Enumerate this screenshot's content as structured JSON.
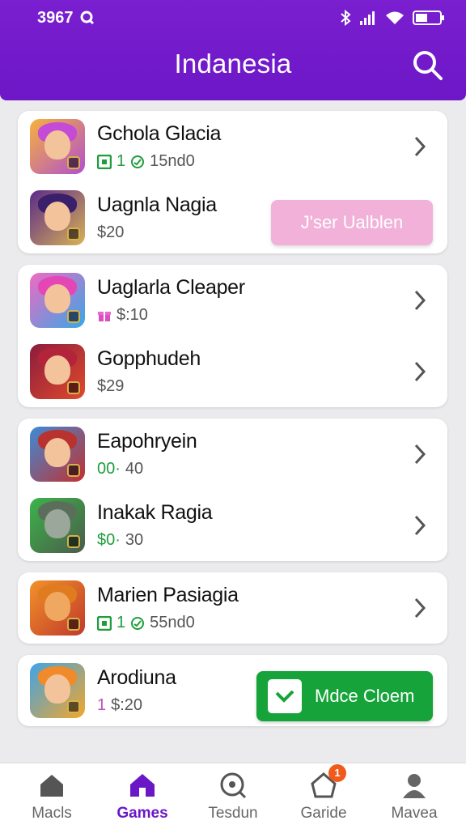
{
  "status_bar": {
    "time": "3967"
  },
  "header": {
    "title": "Indanesia"
  },
  "games": [
    {
      "name": "Gchola Glacia",
      "meta": "15nd0",
      "meta_prefix": "1",
      "colors": [
        "#f6b23a",
        "#b14fd1"
      ]
    },
    {
      "name": "Uagnla Nagia",
      "meta": "$20",
      "action": "J'ser Ualblen",
      "colors": [
        "#5a2a8a",
        "#d9b255"
      ]
    },
    {
      "name": "Uaglarla Cleaper",
      "meta": "$:10",
      "colors": [
        "#ef6bc2",
        "#37a7e6"
      ]
    },
    {
      "name": "Gopphudeh",
      "meta": "$29",
      "colors": [
        "#8b1c3d",
        "#e04a2c"
      ]
    },
    {
      "name": "Eapohryein",
      "meta": "40",
      "meta_prefix": "00·",
      "colors": [
        "#3d8bd6",
        "#c42f2f"
      ]
    },
    {
      "name": "Inakak Ragia",
      "meta": "30",
      "meta_prefix": "$0·",
      "colors": [
        "#3bb54a",
        "#4b5b4b"
      ]
    },
    {
      "name": "Marien Pasiagia",
      "meta": "55nd0",
      "meta_prefix": "1",
      "colors": [
        "#f2922a",
        "#c0392b"
      ]
    },
    {
      "name": "Arodiuna",
      "meta": "$:20",
      "meta_prefix": "1",
      "action": "Mdce Cloem",
      "colors": [
        "#3ea3e8",
        "#f4a62a"
      ]
    }
  ],
  "tabs": [
    {
      "label": "Macls",
      "icon": "home-icon"
    },
    {
      "label": "Games",
      "icon": "home-icon"
    },
    {
      "label": "Tesdun",
      "icon": "search-icon"
    },
    {
      "label": "Garide",
      "icon": "tag-icon",
      "badge": "1"
    },
    {
      "label": "Mavea",
      "icon": "profile-icon"
    }
  ],
  "colors": {
    "brand": "#6d17c7",
    "accent_green": "#16a33a",
    "accent_pink": "#f2b1d9"
  }
}
